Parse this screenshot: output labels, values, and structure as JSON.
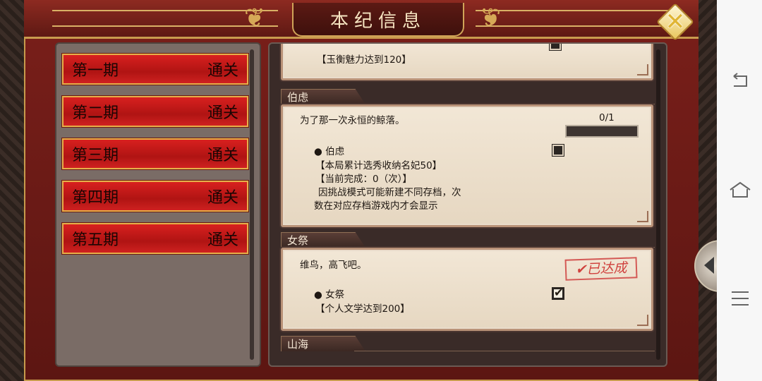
{
  "header": {
    "title": "本纪信息"
  },
  "periods": [
    {
      "name": "第一期",
      "status": "通关"
    },
    {
      "name": "第二期",
      "status": "通关"
    },
    {
      "name": "第三期",
      "status": "通关"
    },
    {
      "name": "第四期",
      "status": "通关"
    },
    {
      "name": "第五期",
      "status": "通关"
    }
  ],
  "sections": {
    "top_partial": {
      "detail": "【玉衡魅力达到120】"
    },
    "bolu": {
      "tab": "伯虑",
      "description": "为了那一次永恒的鲸落。",
      "progress_text": "0/1",
      "progress_fraction": 0,
      "item_name": "● 伯虑",
      "requirement": "【本局累计选秀收纳名妃50】",
      "current": "【当前完成：0（次）】",
      "note_line1": "因挑战模式可能新建不同存档，次",
      "note_line2": "数在对应存档游戏内才会显示",
      "checked": false
    },
    "nvji": {
      "tab": "女祭",
      "description": "维鸟，高飞吧。",
      "stamp": "✔已达成",
      "item_name": "● 女祭",
      "requirement": "【个人文学达到200】",
      "checked": true
    },
    "shanhai": {
      "tab": "山海"
    }
  },
  "colors": {
    "frame_red": "#7a1f1a",
    "gold_trim": "#d0a458",
    "period_red": "#c4191a",
    "parchment": "#efe3d1",
    "stamp_red": "#d0413d"
  },
  "icons": {
    "close": "close-x-icon",
    "back": "android-back-icon",
    "home": "android-home-icon",
    "menu": "android-menu-icon",
    "side_arrow": "left-arrow-icon"
  }
}
